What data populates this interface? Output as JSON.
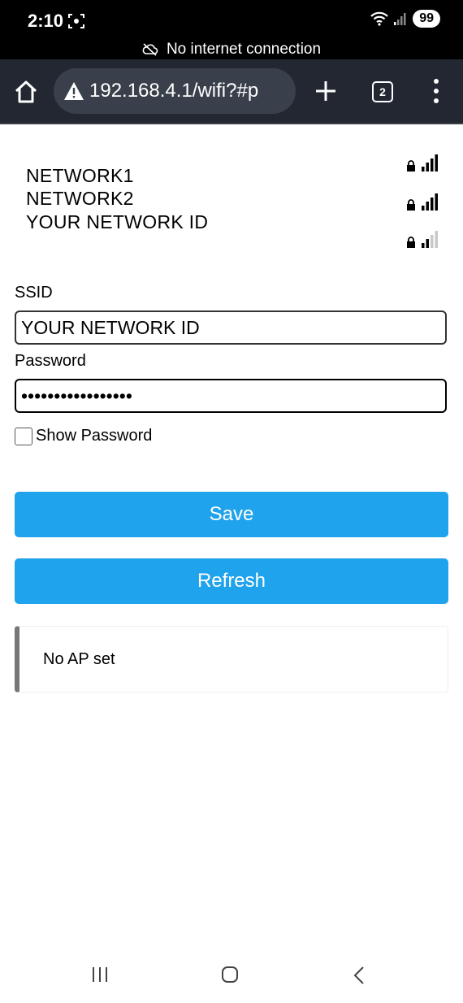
{
  "status_bar": {
    "time": "2:10",
    "battery": "99",
    "icons": [
      "screen-record-icon",
      "wifi-icon",
      "cell-signal-icon"
    ]
  },
  "offline_banner": {
    "text": "No internet connection",
    "icon": "cloud-off-icon"
  },
  "browser_toolbar": {
    "address": "192.168.4.1/wifi?#p",
    "tab_count": "2",
    "icons": [
      "home-icon",
      "warning-icon",
      "plus-icon",
      "tabs-icon",
      "more-vert-icon"
    ]
  },
  "networks": [
    {
      "name": "NETWORK1",
      "signal_bars": 4,
      "secured": true
    },
    {
      "name": "NETWORK2",
      "signal_bars": 4,
      "secured": true
    },
    {
      "name": "YOUR NETWORK ID",
      "signal_bars": 2,
      "secured": true
    }
  ],
  "form": {
    "ssid_label": "SSID",
    "ssid_value": "YOUR NETWORK ID",
    "password_label": "Password",
    "password_value": "•••••••••••••••••",
    "show_password_label": "Show Password",
    "save_label": "Save",
    "refresh_label": "Refresh"
  },
  "message": {
    "text": "No AP set"
  },
  "colors": {
    "button": "#1fa3ec",
    "toolbar": "#222731",
    "message_border": "#777777"
  }
}
